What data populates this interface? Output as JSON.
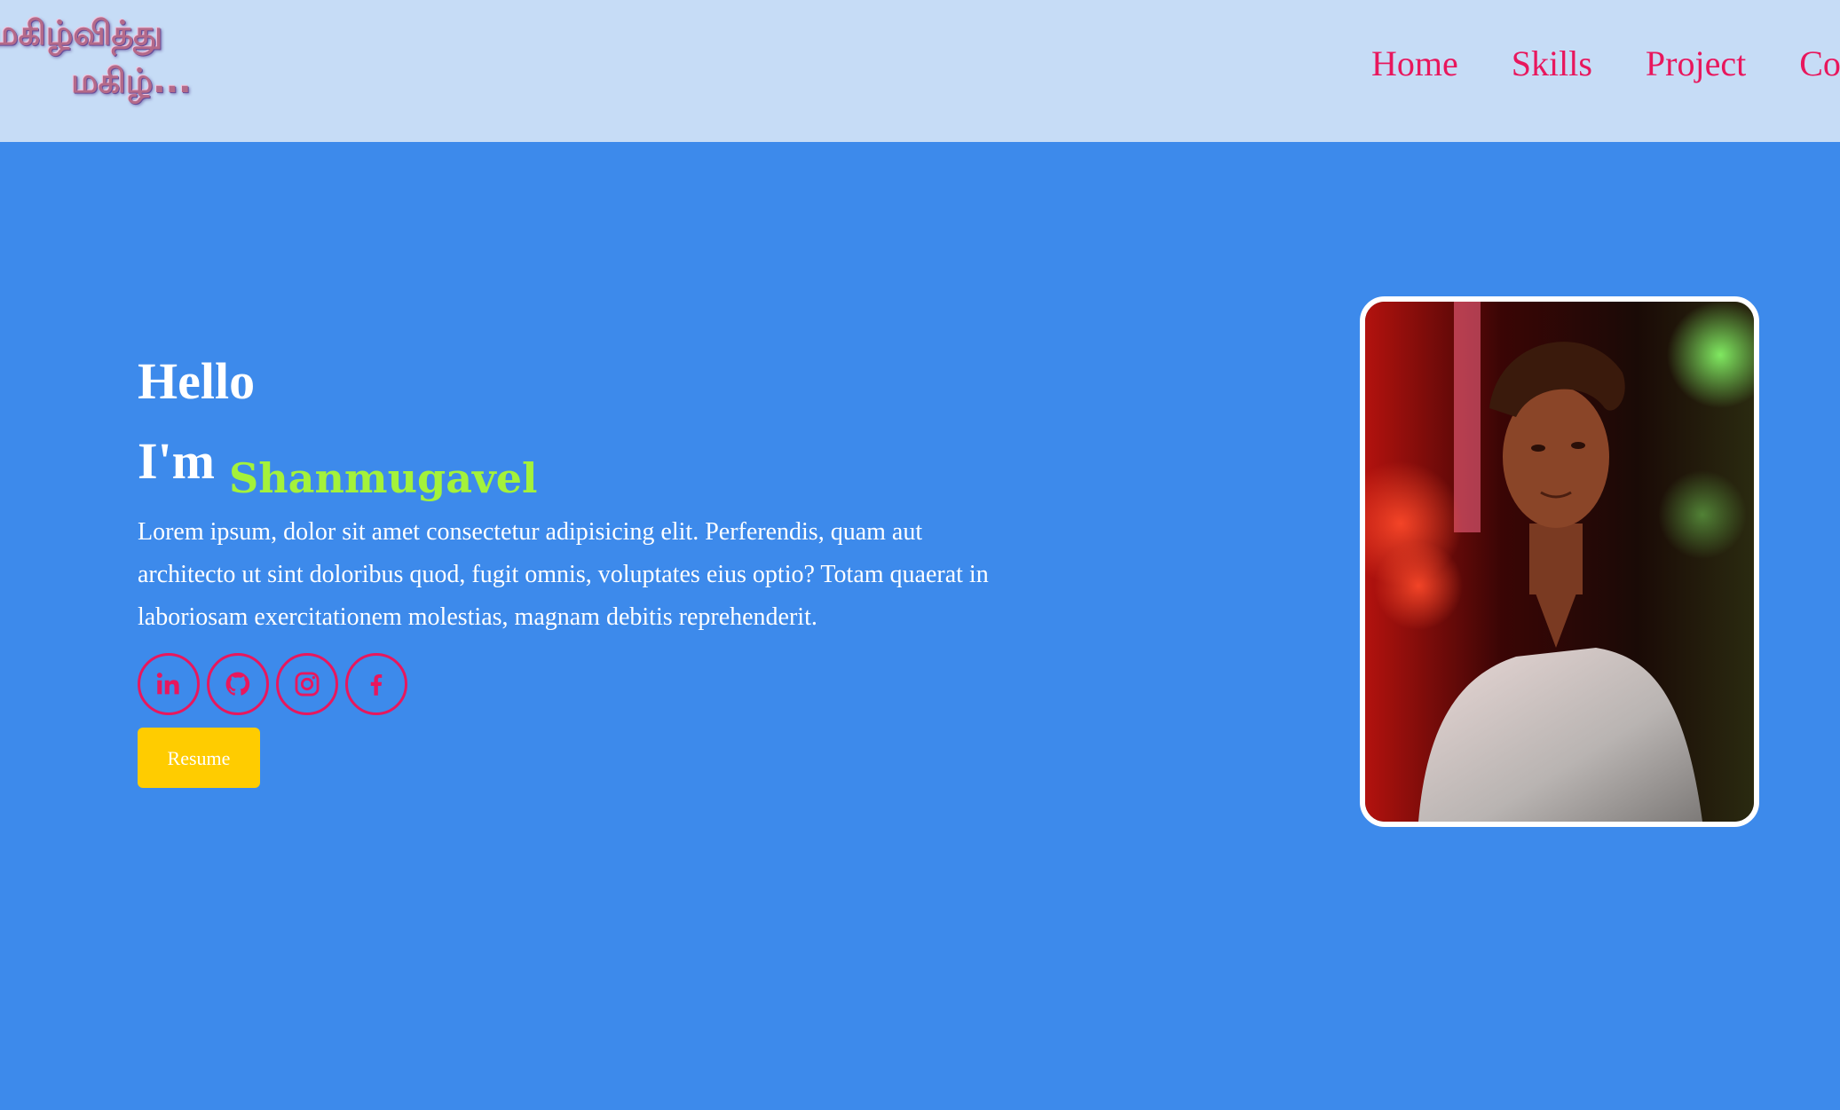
{
  "navbar": {
    "logo_line1": "மகிழ்வித்து",
    "logo_line2": "மகிழ்...",
    "links": [
      "Home",
      "Skills",
      "Project",
      "Contact"
    ]
  },
  "hero": {
    "greeting": "Hello",
    "intro": "I'm",
    "name": "Shanmugavel",
    "bio": "Lorem ipsum, dolor sit amet consectetur adipisicing elit. Perferendis, quam aut architecto ut sint doloribus quod, fugit omnis, voluptates eius optio? Totam quaerat in laboriosam exercitationem molestias, magnam debitis reprehenderit.",
    "resume_label": "Resume"
  },
  "socials": [
    {
      "icon": "linkedin-icon"
    },
    {
      "icon": "github-icon"
    },
    {
      "icon": "instagram-icon"
    },
    {
      "icon": "facebook-icon"
    }
  ],
  "colors": {
    "page_background": "#3d8aeb",
    "navbar_background": "#c6dcf6",
    "nav_link": "#e8175d",
    "name_highlight": "#a4f23a",
    "resume_button": "#ffcc00"
  }
}
